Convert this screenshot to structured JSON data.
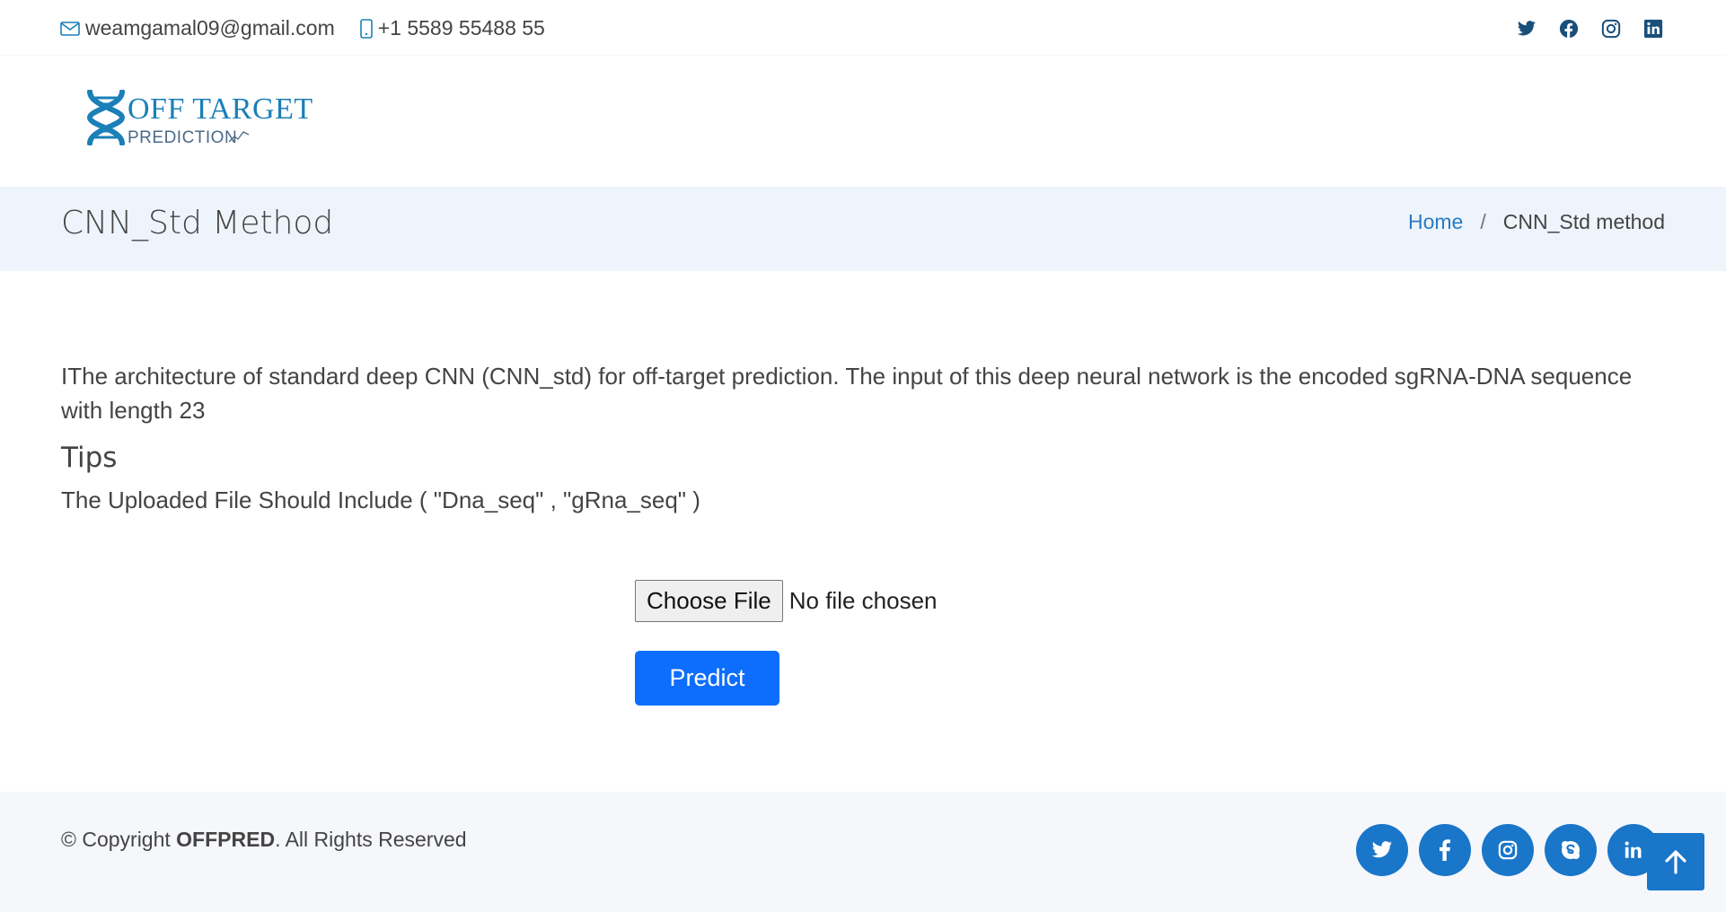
{
  "topbar": {
    "email": "weamgamal09@gmail.com",
    "phone": "+1 5589 55488 55",
    "social_icons": [
      "twitter-icon",
      "facebook-icon",
      "instagram-icon",
      "linkedin-icon"
    ]
  },
  "logo": {
    "title": "OFF TARGET",
    "subtitle": "PREDICTION"
  },
  "page": {
    "title": "CNN_Std Method",
    "breadcrumb": {
      "home": "Home",
      "separator": "/",
      "current": "CNN_Std method"
    }
  },
  "content": {
    "description": "IThe architecture of standard deep CNN (CNN_std) for off-target prediction. The input of this deep neural network is the encoded sgRNA-DNA sequence with length 23",
    "tips_heading": "Tips",
    "tips_text": "The Uploaded File Should Include ( \"Dna_seq\" , \"gRna_seq\" )"
  },
  "form": {
    "choose_file_label": "Choose File",
    "file_status": "No file chosen",
    "predict_label": "Predict"
  },
  "footer": {
    "copyright_prefix": "© Copyright ",
    "brand": "OFFPRED",
    "copyright_suffix": ". All Rights Reserved",
    "social_icons": [
      "twitter-icon",
      "facebook-icon",
      "instagram-icon",
      "skype-icon",
      "linkedin-icon"
    ]
  },
  "colors": {
    "accent": "#0d6efd",
    "footer_social": "#1976c9",
    "link": "#2a7bc4",
    "band": "#eef4fb"
  }
}
